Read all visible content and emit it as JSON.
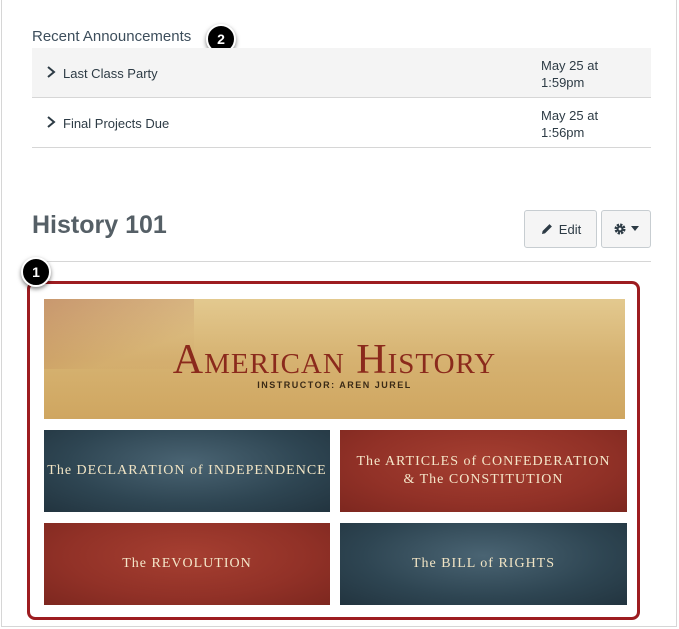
{
  "announcements": {
    "title": "Recent Announcements",
    "badge": "2",
    "items": [
      {
        "label": "Last Class Party",
        "date": "May 25 at 1:59pm"
      },
      {
        "label": "Final Projects Due",
        "date": "May 25 at 1:56pm"
      }
    ]
  },
  "course": {
    "title": "History 101",
    "edit_label": "Edit",
    "badge": "1"
  },
  "tiles": {
    "hero_title": "American History",
    "hero_subtitle": "INSTRUCTOR: AREN JUREL",
    "declaration": "The DECLARATION of INDEPENDENCE",
    "articles_line1": "The ARTICLES of CONFEDERATION",
    "articles_line2": "& The CONSTITUTION",
    "revolution": "The REVOLUTION",
    "bill": "The BILL of RIGHTS"
  },
  "colors": {
    "highlight_border": "#9d1c20",
    "tile_blue": "#2e4552",
    "tile_red": "#913127"
  }
}
